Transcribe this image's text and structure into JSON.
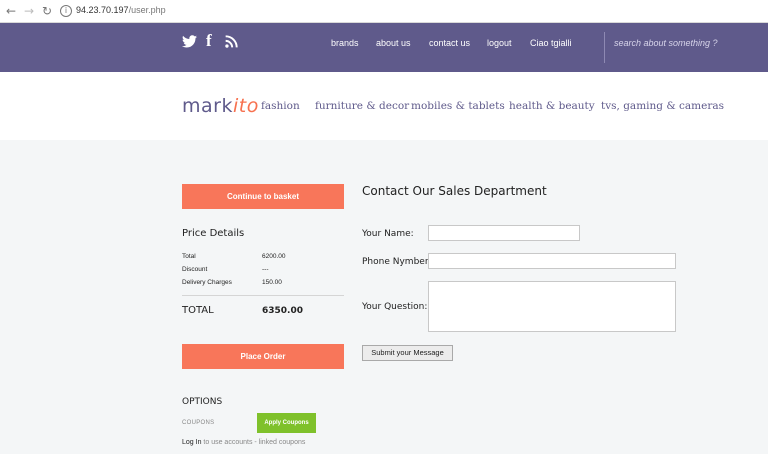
{
  "browser": {
    "back_icon": "back-arrow-icon",
    "forward_icon": "forward-arrow-icon",
    "reload_icon": "reload-icon",
    "url_host": "94.23.70.197",
    "url_path": "/user.php"
  },
  "topbar": {
    "bg_color": "#5f5a8b",
    "links": [
      "brands",
      "about us",
      "contact us",
      "logout",
      "Ciao tgialli"
    ],
    "search_placeholder": "search about something ?"
  },
  "header": {
    "logo_main": "mark",
    "logo_accent": "ito",
    "categories": [
      "fashion",
      "furniture & decor",
      "mobiles & tablets",
      "health & beauty",
      "tvs, gaming & cameras"
    ]
  },
  "cart": {
    "continue_label": "Continue to basket",
    "price_title": "Price Details",
    "rows": [
      {
        "label": "Total",
        "value": "6200.00"
      },
      {
        "label": "Discount",
        "value": "---"
      },
      {
        "label": "Delivery Charges",
        "value": "150.00"
      }
    ],
    "total_label": "TOTAL",
    "total_value": "6350.00",
    "place_order_label": "Place Order",
    "options_title": "OPTIONS",
    "coupons_label": "COUPONS",
    "apply_label": "Apply Coupons",
    "login_strong": "Log In",
    "login_rest": " to use accounts - linked coupons",
    "accent_color": "#f8765a",
    "green_color": "#7fc12b"
  },
  "contact": {
    "title": "Contact Our Sales Department",
    "name_label": "Your Name:",
    "phone_label": "Phone Nymber:",
    "question_label": "Your Question:",
    "submit_label": "Submit your Message"
  }
}
